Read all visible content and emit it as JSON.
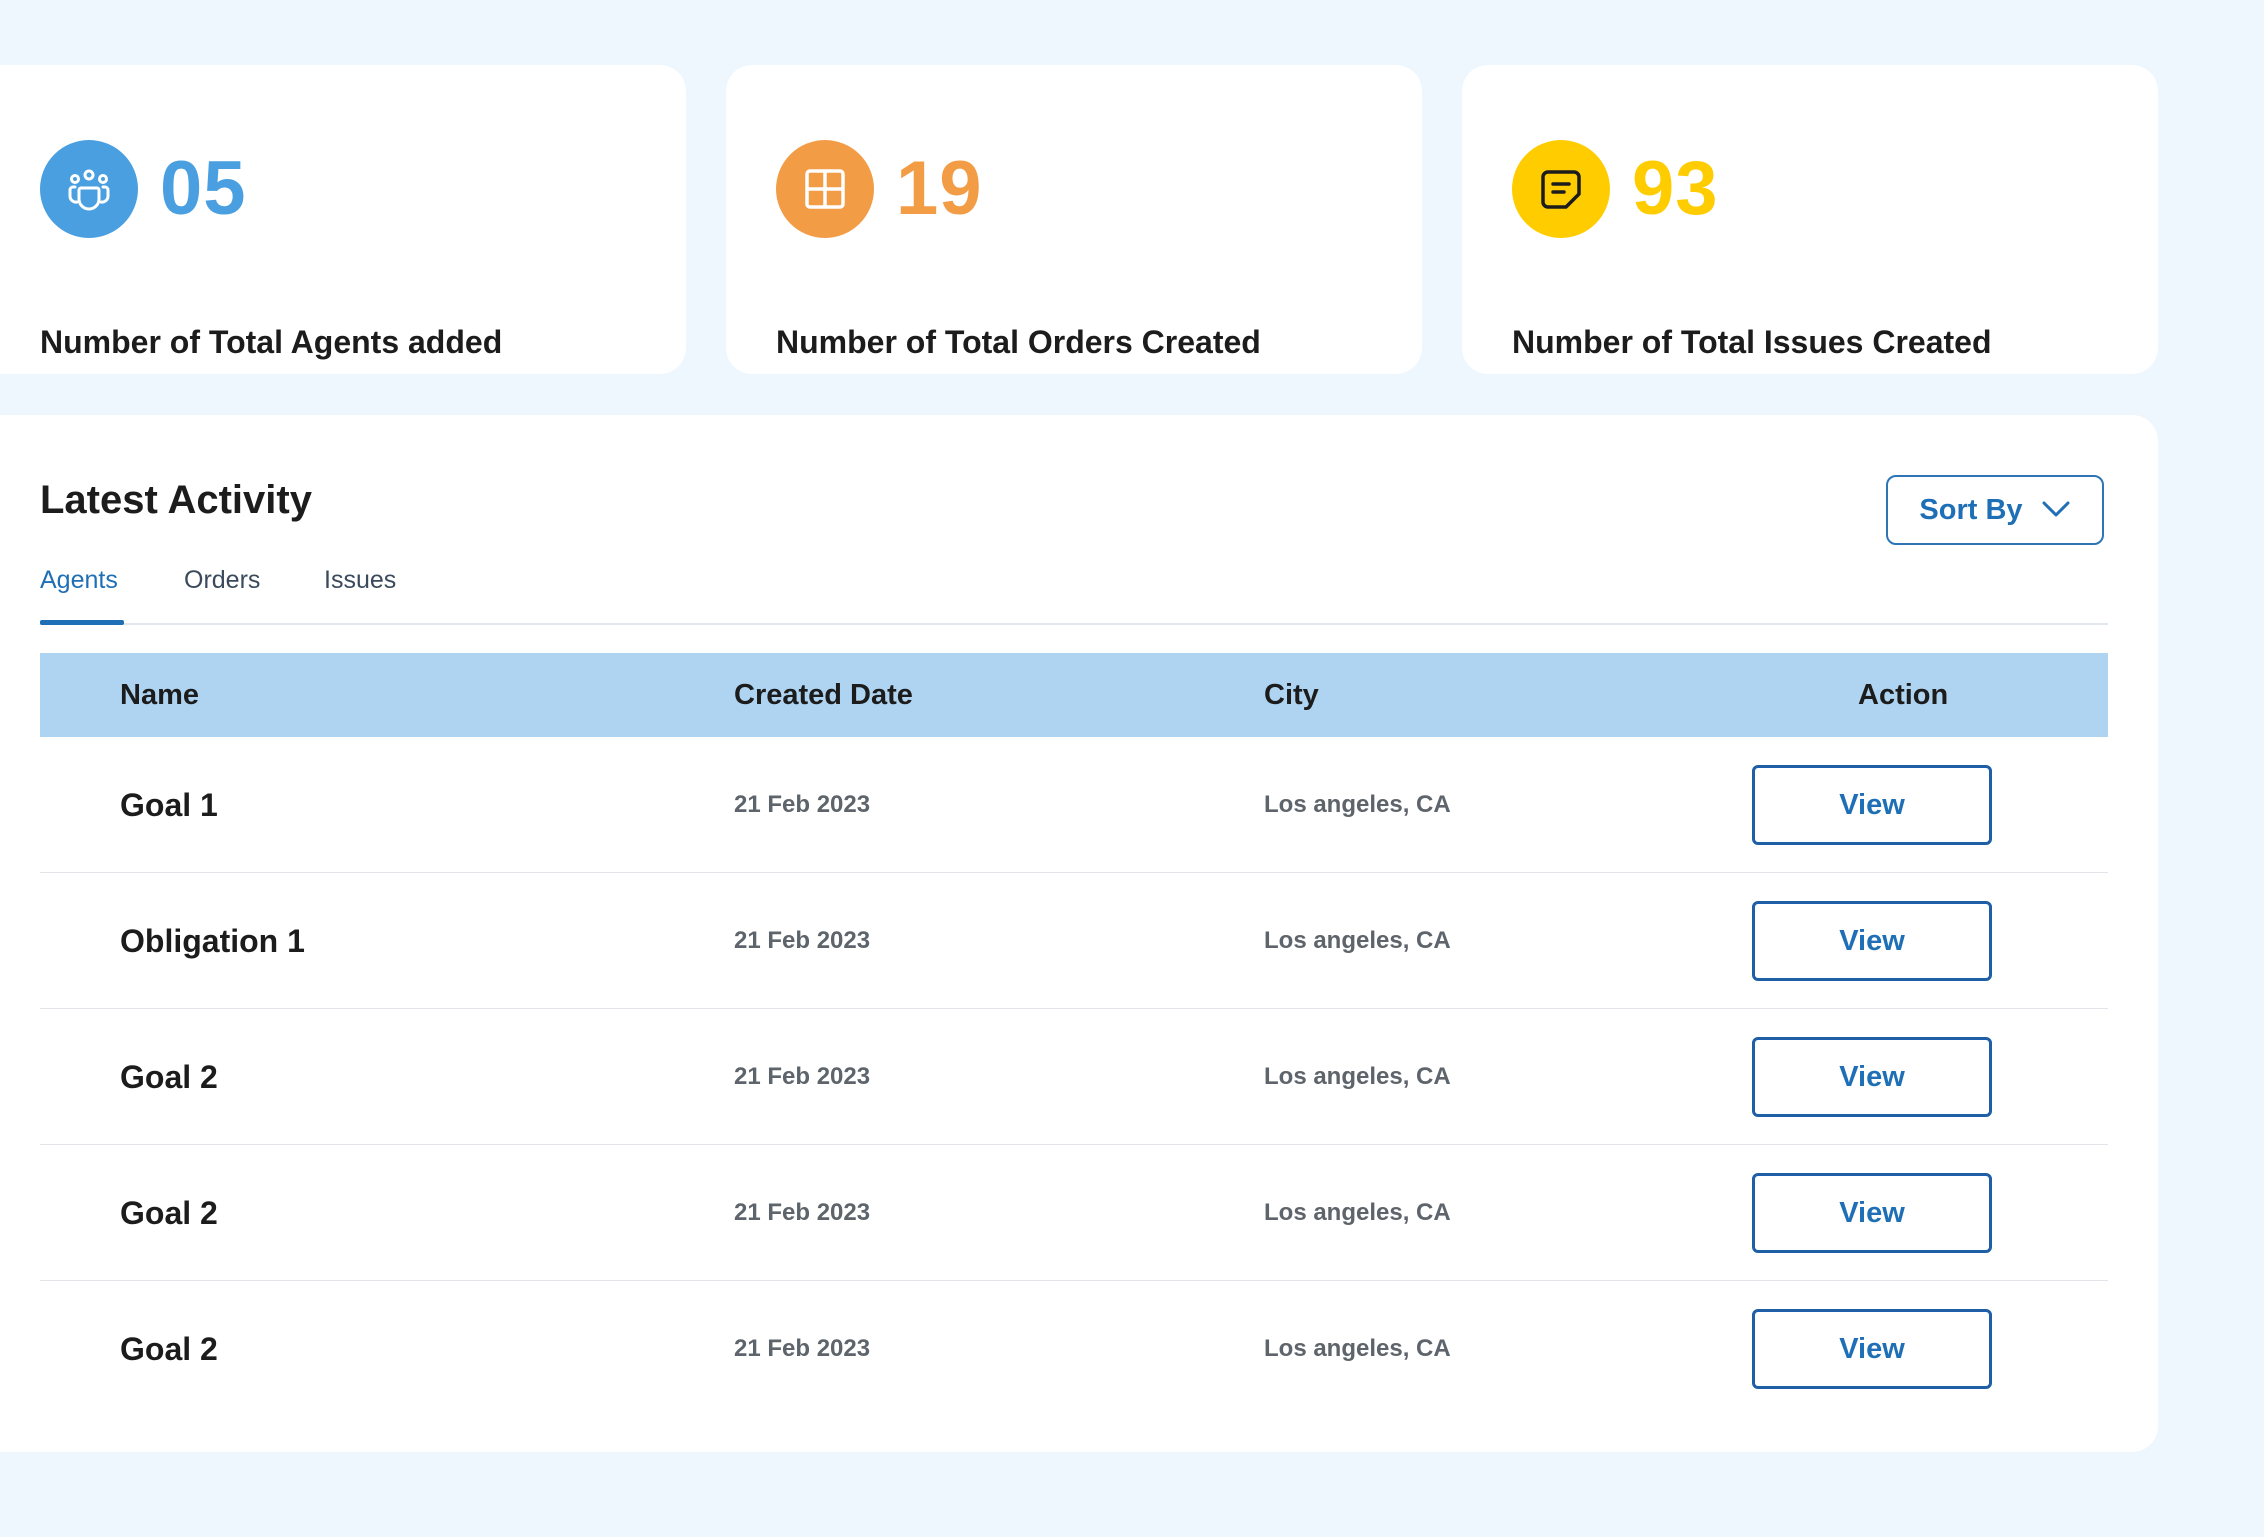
{
  "colors": {
    "page_background": "#EEF6FE",
    "agents_accent": "#4A9FE0",
    "orders_accent": "#F39C46",
    "issues_accent": "#FFCC00",
    "primary_blue": "#1E6FB5",
    "table_header_bg": "#AED4F1"
  },
  "stats": {
    "agents": {
      "value": "05",
      "label": "Number of Total Agents added",
      "icon": "users-group-icon"
    },
    "orders": {
      "value": "19",
      "label": "Number of Total Orders Created",
      "icon": "grid-icon"
    },
    "issues": {
      "value": "93",
      "label": "Number of Total Issues Created",
      "icon": "note-icon"
    }
  },
  "activity": {
    "title": "Latest Activity",
    "sort_label": "Sort By",
    "sort_icon": "chevron-down-icon",
    "tabs": [
      {
        "label": "Agents",
        "active": true
      },
      {
        "label": "Orders",
        "active": false
      },
      {
        "label": "Issues",
        "active": false
      }
    ],
    "columns": [
      "Name",
      "Created Date",
      "City",
      "Action"
    ],
    "rows": [
      {
        "name": "Goal 1",
        "date": "21 Feb 2023",
        "city": "Los angeles, CA",
        "action": "View"
      },
      {
        "name": "Obligation 1",
        "date": "21 Feb 2023",
        "city": "Los angeles, CA",
        "action": "View"
      },
      {
        "name": "Goal 2",
        "date": "21 Feb 2023",
        "city": "Los angeles, CA",
        "action": "View"
      },
      {
        "name": "Goal 2",
        "date": "21 Feb 2023",
        "city": "Los angeles, CA",
        "action": "View"
      },
      {
        "name": "Goal 2",
        "date": "21 Feb 2023",
        "city": "Los angeles, CA",
        "action": "View"
      }
    ]
  }
}
